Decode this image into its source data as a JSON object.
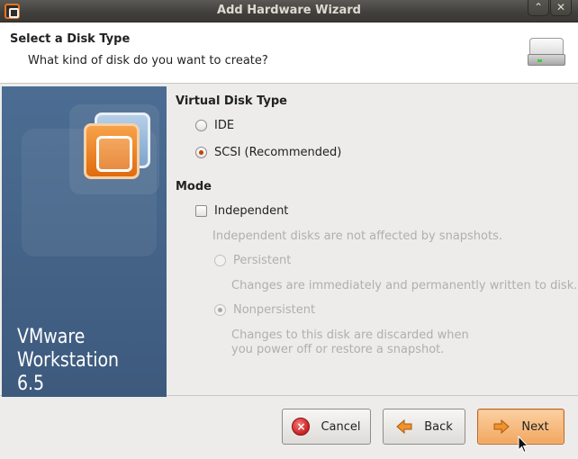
{
  "window": {
    "title": "Add Hardware Wizard",
    "minimize_glyph": "⌃",
    "close_glyph": "✕"
  },
  "header": {
    "title": "Select a Disk Type",
    "subtitle": "What kind of disk do you want to create?",
    "icon": "hard-disk-icon"
  },
  "side_panel": {
    "product_line1": "VMware",
    "product_line2": "Workstation 6.5",
    "logo": "vmware-logo"
  },
  "virtual_disk_type": {
    "heading": "Virtual Disk Type",
    "options": [
      {
        "label": "IDE",
        "checked": false
      },
      {
        "label": "SCSI (Recommended)",
        "checked": true
      }
    ]
  },
  "mode": {
    "heading": "Mode",
    "independent_label": "Independent",
    "independent_checked": false,
    "independent_desc": "Independent disks are not affected by snapshots.",
    "persistent_label": "Persistent",
    "persistent_desc": "Changes are immediately and permanently written to disk.",
    "nonpersistent_label": "Nonpersistent",
    "nonpersistent_desc_line1": "Changes to this disk are discarded when",
    "nonpersistent_desc_line2": "you power off or restore a snapshot."
  },
  "buttons": {
    "cancel": "Cancel",
    "back": "Back",
    "next": "Next"
  },
  "colors": {
    "side_panel": "#4c6d93",
    "accent_orange": "#e06b0e",
    "titlebar": "#403f3b"
  }
}
